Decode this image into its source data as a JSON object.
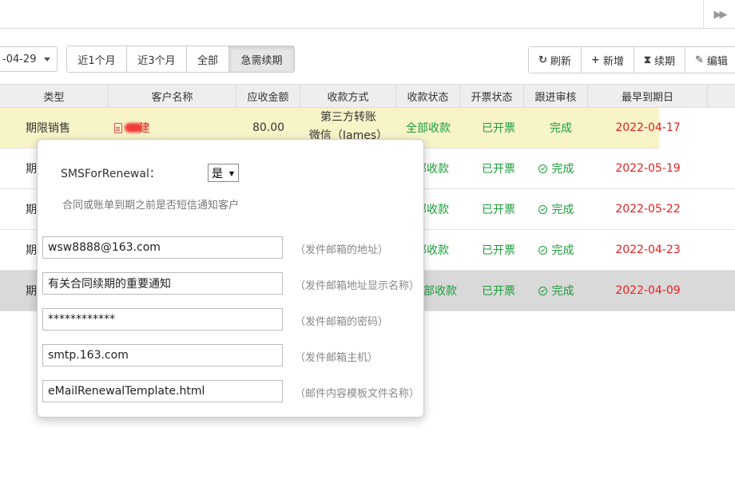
{
  "topbar": {
    "expand_icon": "double-chevron-right-icon",
    "expand_glyph": "▶▶"
  },
  "toolbar": {
    "date_value": "-04-29",
    "ranges": [
      {
        "label": "近1个月",
        "active": false
      },
      {
        "label": "近3个月",
        "active": false
      },
      {
        "label": "全部",
        "active": false
      },
      {
        "label": "急需续期",
        "active": true
      }
    ],
    "actions": [
      {
        "label": "刷新",
        "icon": "refresh-icon",
        "glyph": "↻"
      },
      {
        "label": "新增",
        "icon": "plus-icon",
        "glyph": "+"
      },
      {
        "label": "续期",
        "icon": "hourglass-icon",
        "glyph": "⧗"
      },
      {
        "label": "编辑",
        "icon": "edit-icon",
        "glyph": "✎"
      }
    ]
  },
  "table": {
    "headers": [
      "类型",
      "客户名称",
      "应收金额",
      "收款方式",
      "收款状态",
      "开票状态",
      "跟进审核",
      "最早到期日"
    ],
    "rows": [
      {
        "type": "期限销售",
        "customer_suffix": "建",
        "amount": "80.00",
        "pay_method_1": "第三方转账",
        "pay_method_2": "微信（James）",
        "pay_status": "全部收款",
        "invoice": "已开票",
        "audit": "完成",
        "due": "2022-04-17"
      },
      {
        "type": "期",
        "pay_status": "部收款",
        "invoice": "已开票",
        "audit": "完成",
        "due": "2022-05-19"
      },
      {
        "type": "期",
        "pay_status": "部收款",
        "invoice": "已开票",
        "audit": "完成",
        "due": "2022-05-22"
      },
      {
        "type": "期",
        "pay_status": "部收款",
        "invoice": "已开票",
        "audit": "完成",
        "due": "2022-04-23"
      },
      {
        "type": "期",
        "pay_status": "部收款",
        "invoice": "已开票",
        "audit": "完成",
        "due": "2022-04-09"
      }
    ]
  },
  "popover": {
    "sms_label": "SMSForRenewal：",
    "sms_value": "是",
    "sms_hint": "合同或账单到期之前是否短信通知客户",
    "fields": [
      {
        "value": "wsw8888@163.com",
        "hint": "（发件邮箱的地址）"
      },
      {
        "value": "有关合同续期的重要通知",
        "hint": "（发件邮箱地址显示名称）"
      },
      {
        "value": "************",
        "hint": "（发件邮箱的密码）"
      },
      {
        "value": "smtp.163.com",
        "hint": "（发件邮箱主机）"
      },
      {
        "value": "eMailRenewalTemplate.html",
        "hint": "（邮件内容模板文件名称）"
      }
    ]
  },
  "colors": {
    "green": "#1a9d3a",
    "red": "#e32020",
    "highlight_row": "#f7f4c8",
    "selected_row": "#d9d9d9"
  }
}
